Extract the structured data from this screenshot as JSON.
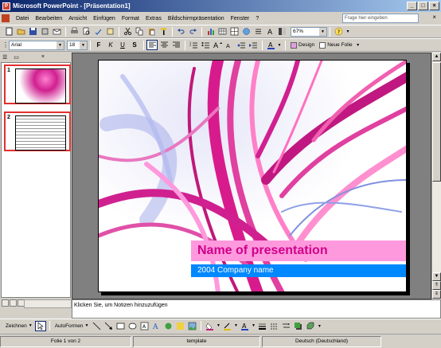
{
  "window": {
    "title": "Microsoft PowerPoint - [Präsentation1]"
  },
  "menu": {
    "items": [
      "Datei",
      "Bearbeiten",
      "Ansicht",
      "Einfügen",
      "Format",
      "Extras",
      "Bildschirmpräsentation",
      "Fenster",
      "?"
    ],
    "help_placeholder": "Frage hier eingeben"
  },
  "toolbar": {
    "zoom": "67%",
    "font": "Arial",
    "font_size": "18",
    "design_label": "Design",
    "new_slide_label": "Neue Folie"
  },
  "outline": {
    "slides": [
      {
        "number": "1",
        "label": "1"
      },
      {
        "number": "2",
        "label": "2"
      }
    ]
  },
  "slide": {
    "title": "Name of presentation",
    "subtitle": "2004 Company name"
  },
  "notes": {
    "placeholder": "Klicken Sie, um Notizen hinzuzufügen"
  },
  "drawing": {
    "draw_label": "Zeichnen",
    "autoshapes_label": "AutoFormen"
  },
  "status": {
    "slide_info": "Folie 1 von 2",
    "template": "template",
    "language": "Deutsch (Deutschland)"
  },
  "colors": {
    "title_text": "#d0008a",
    "title_band": "#ff99dd",
    "subtitle_band": "#0088ff",
    "annotation_red": "#e03030"
  }
}
